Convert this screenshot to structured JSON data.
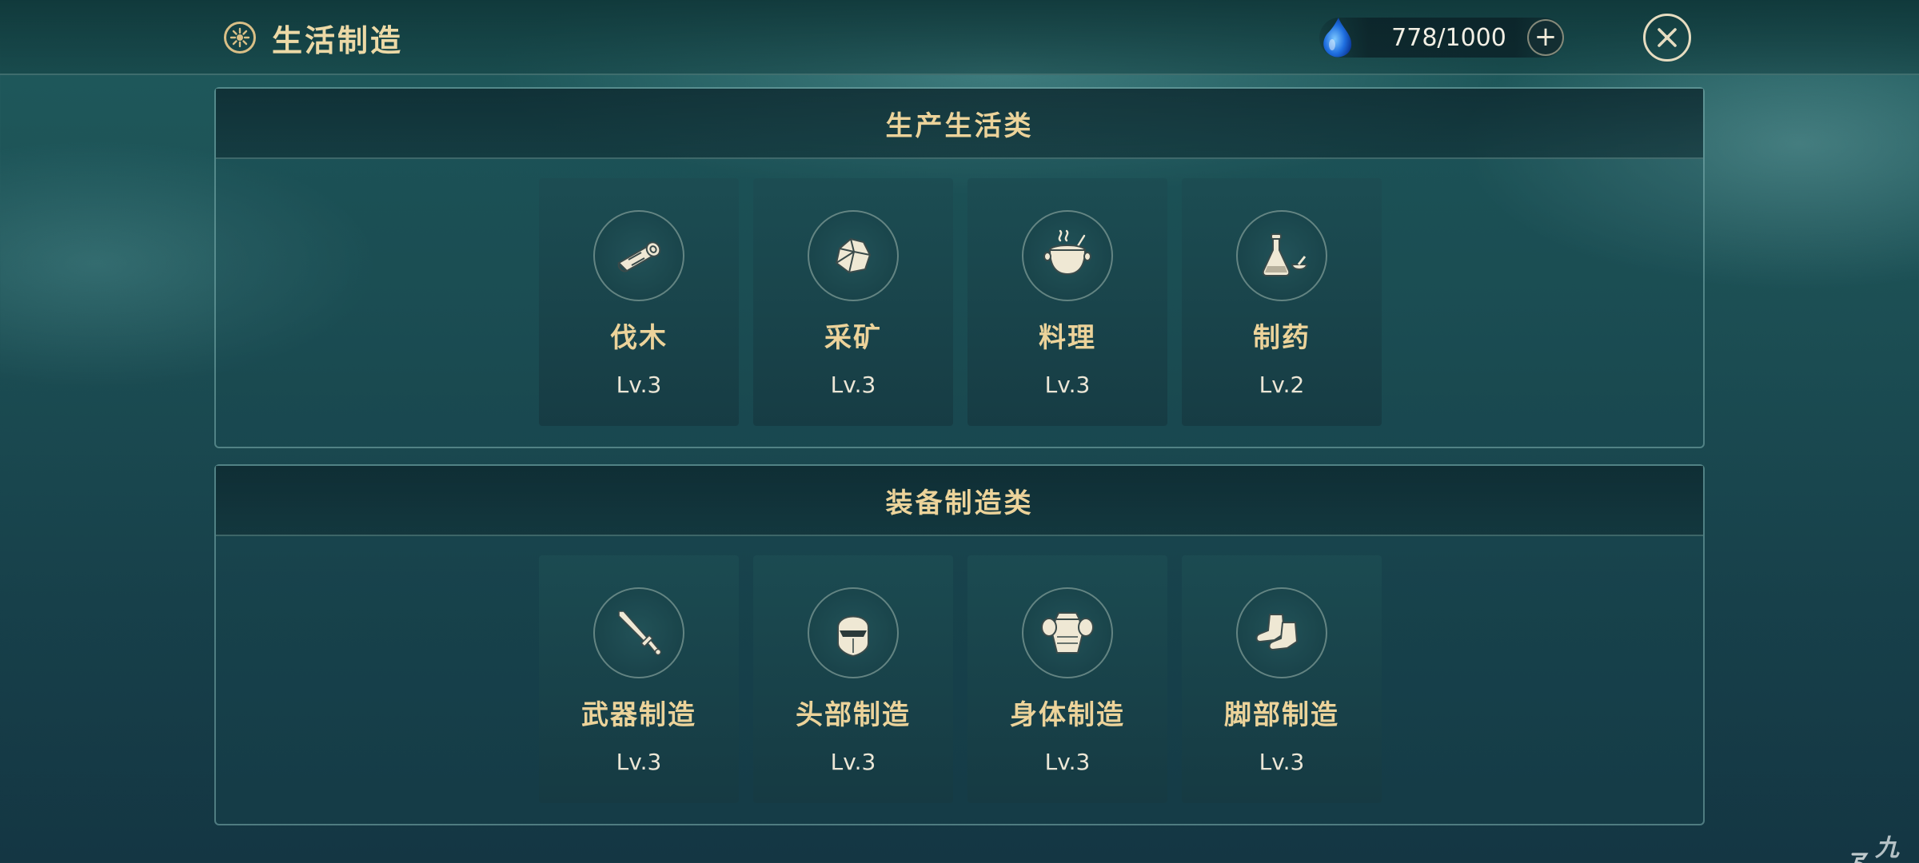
{
  "header": {
    "title": "生活制造",
    "title_icon": "wheel-icon",
    "energy": {
      "value": "778/1000",
      "icon": "water-drop-icon",
      "add_label": "+"
    },
    "close_icon": "close-icon"
  },
  "sections": [
    {
      "title": "生产生活类",
      "cards": [
        {
          "name": "伐木",
          "level": "Lv.3",
          "icon": "log-icon"
        },
        {
          "name": "采矿",
          "level": "Lv.3",
          "icon": "ore-icon"
        },
        {
          "name": "料理",
          "level": "Lv.3",
          "icon": "cooking-pot-icon"
        },
        {
          "name": "制药",
          "level": "Lv.2",
          "icon": "potion-flask-icon"
        }
      ]
    },
    {
      "title": "装备制造类",
      "cards": [
        {
          "name": "武器制造",
          "level": "Lv.3",
          "icon": "sword-icon"
        },
        {
          "name": "头部制造",
          "level": "Lv.3",
          "icon": "helmet-icon"
        },
        {
          "name": "身体制造",
          "level": "Lv.3",
          "icon": "armor-icon"
        },
        {
          "name": "脚部制造",
          "level": "Lv.3",
          "icon": "boots-icon"
        }
      ]
    }
  ],
  "watermark": {
    "text": "九游",
    "icon": "logo-mark"
  },
  "colors": {
    "accent_gold": "#ecd39a",
    "panel_border": "#96cdc8",
    "background": "#1c4f54"
  }
}
